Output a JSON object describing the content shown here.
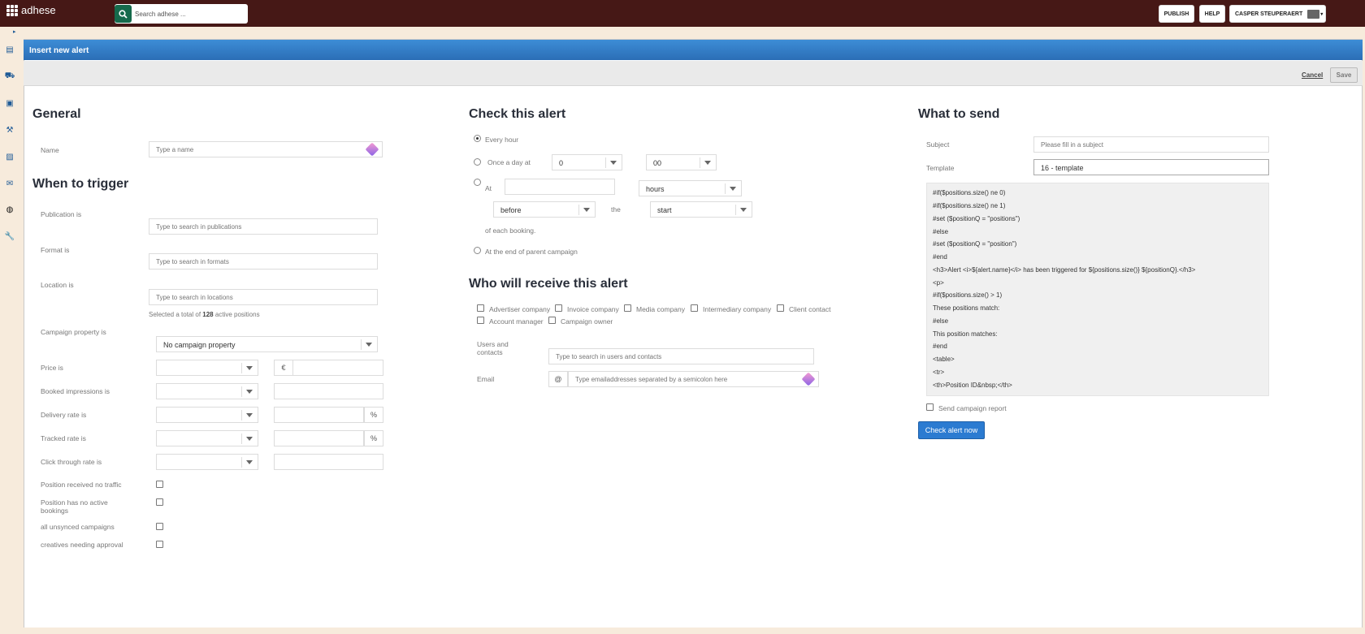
{
  "app": {
    "name": "adhese"
  },
  "topbar": {
    "search_placeholder": "Search adhese ...",
    "publish_label": "PUBLISH",
    "help_label": "HELP",
    "user_label": "CASPER STEUPERAERT"
  },
  "sidebar": {
    "icons": [
      "newspaper-icon",
      "truck-icon",
      "briefcase-icon",
      "gavel-icon",
      "image-icon",
      "envelope-icon",
      "bell-icon",
      "wrench-icon"
    ]
  },
  "dialog": {
    "title": "Insert new alert",
    "cancel_label": "Cancel",
    "save_label": "Save"
  },
  "general": {
    "heading": "General",
    "name_label": "Name",
    "name_placeholder": "Type a name"
  },
  "trigger": {
    "heading": "When to trigger",
    "publication_label": "Publication is",
    "publication_placeholder": "Type to search in publications",
    "format_label": "Format is",
    "format_placeholder": "Type to search in formats",
    "location_label": "Location is",
    "location_placeholder": "Type to search in locations",
    "positions_prefix": "Selected a total of",
    "positions_count": "128",
    "positions_suffix": "active positions",
    "campaign_property_label": "Campaign property is",
    "campaign_property_value": "No campaign property",
    "price_label": "Price is",
    "currency_symbol": "€",
    "booked_label": "Booked impressions is",
    "delivery_label": "Delivery rate is",
    "tracked_label": "Tracked rate is",
    "ctr_label": "Click through rate is",
    "percent_symbol": "%",
    "no_traffic_label": "Position received no traffic",
    "no_bookings_label": "Position has no active bookings",
    "unsynced_label": "all unsynced campaigns",
    "creatives_label": "creatives needing approval"
  },
  "check": {
    "heading": "Check this alert",
    "every_hour": "Every hour",
    "once_a_day": "Once a day at",
    "hour_value": "0",
    "minute_value": "00",
    "at_label": "At",
    "unit_value": "hours",
    "relation_value": "before",
    "the_label": "the",
    "anchor_value": "start",
    "of_each_booking": "of each booking.",
    "end_of_parent": "At the end of parent campaign"
  },
  "receivers": {
    "heading": "Who will receive this alert",
    "checkboxes": [
      "Advertiser company",
      "Invoice company",
      "Media company",
      "Intermediary company",
      "Client contact",
      "Account manager",
      "Campaign owner"
    ],
    "users_label": "Users and contacts",
    "users_placeholder": "Type to search in users and contacts",
    "email_label": "Email",
    "email_prefix": "@",
    "email_placeholder": "Type emailaddresses separated by a semicolon here"
  },
  "send": {
    "heading": "What to send",
    "subject_label": "Subject",
    "subject_placeholder": "Please fill in a subject",
    "template_label": "Template",
    "template_value": "16 - template",
    "code_lines": [
      "#if($positions.size() ne 0)",
      "#if($positions.size() ne 1)",
      "#set ($positionQ = \"positions\")",
      "#else",
      "#set ($positionQ = \"position\")",
      "#end",
      "<h3>Alert <i>${alert.name}</i> has been triggered for ${positions.size()} ${positionQ}.</h3>",
      "<p>",
      "#if($positions.size() > 1)",
      "These positions match:",
      "#else",
      "This position matches:",
      "#end",
      "<table>",
      "<tr>",
      "<th>Position ID&nbsp;</th>"
    ],
    "campaign_report_label": "Send campaign report",
    "check_now_label": "Check alert now"
  },
  "colors": {
    "topbar": "#461816",
    "header_blue": "#2b6eb6",
    "button_blue": "#2b7bd1",
    "search_green": "#166a4c",
    "background": "#f7ebdc"
  }
}
